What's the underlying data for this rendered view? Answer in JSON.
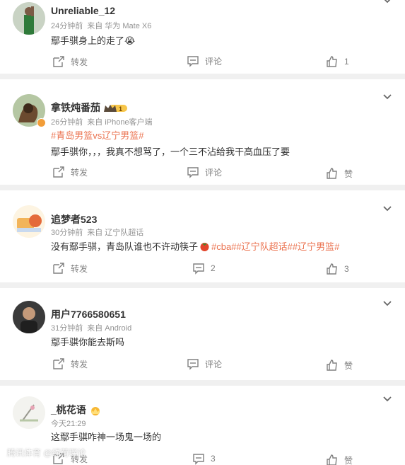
{
  "actions": {
    "repost": "转发",
    "comment": "评论",
    "like": "赞"
  },
  "watermark": "腾讯体育 @绿荷琛论",
  "comments": [
    {
      "user": "Unreliable_12",
      "time": "24分钟前",
      "source": "来自 华为 Mate X6",
      "text": "鄢手骐身上的走了",
      "emoji": "😭",
      "comment_count": "",
      "like_count": "1"
    },
    {
      "user": "拿铁炖番茄",
      "level": "1",
      "time": "26分钟前",
      "source": "来自 iPhone客户端",
      "topics": "#青岛男篮vs辽宁男篮#",
      "text": "鄢手骐你，，，我真不想骂了，一个三不沾给我干高血压了要",
      "comment_count": "",
      "like_count": "赞"
    },
    {
      "user": "追梦者523",
      "time": "30分钟前",
      "source": "来自 辽宁队超话",
      "text": "没有鄢手骐，青岛队谁也不许动筷子",
      "topics": "#cba##辽宁队超话##辽宁男篮#",
      "comment_count": "2",
      "like_count": "3"
    },
    {
      "user": "用户7766580651",
      "time": "31分钟前",
      "source": "来自 Android",
      "text": "鄢手骐你能去斯吗",
      "comment_count": "",
      "like_count": "赞"
    },
    {
      "user": "_桃花语",
      "time": "今天21:29",
      "source": "",
      "text": "这鄢手骐咋神一场鬼一场的",
      "comment_count": "3",
      "like_count": "赞"
    }
  ],
  "colors": {
    "topic": "#eb7350",
    "meta": "#939393",
    "background": "#f0f0f0"
  }
}
